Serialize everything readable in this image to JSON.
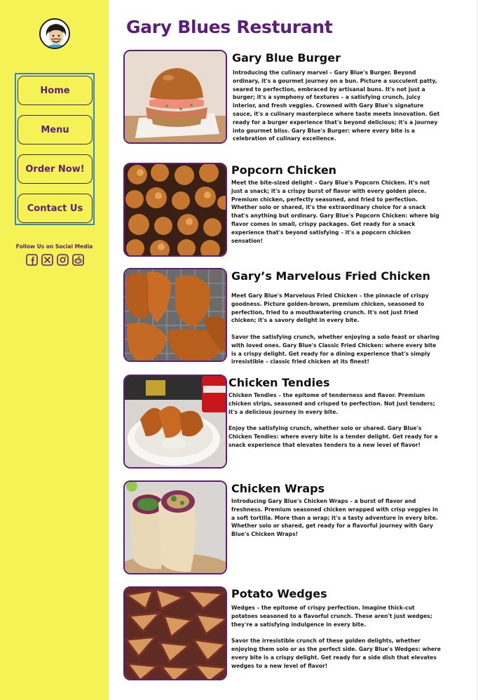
{
  "site": {
    "title": "Gary Blues Resturant"
  },
  "nav": {
    "home": "Home",
    "menu": "Menu",
    "order": "Order Now!",
    "contact": "Contact Us"
  },
  "social": {
    "label": "Follow Us on Social Media",
    "icons": [
      "facebook-icon",
      "x-icon",
      "instagram-icon",
      "reddit-icon"
    ]
  },
  "colors": {
    "sidebar": "#f5f255",
    "accent": "#5b1e7a",
    "nav_border": "#2a86d8"
  },
  "items": [
    {
      "name": "Gary Blue Burger",
      "paragraphs": [
        "Introducing the culinary marvel – Gary Blue's Burger. Beyond ordinary, it's a gourmet journey on a bun. Picture a succulent patty, seared to perfection, embraced by artisanal buns. It's not just a burger; it's a symphony of textures – a satisfying crunch, juicy interior, and fresh veggies. Crowned with Gary Blue's signature sauce, it's a culinary masterpiece where taste meets innovation. Get ready for a burger experience that's beyond delicious; it's a journey into gourmet bliss. Gary Blue's Burger: where every bite is a celebration of culinary excellence."
      ]
    },
    {
      "name": "Popcorn Chicken",
      "paragraphs": [
        "Meet the bite-sized delight – Gary Blue's Popcorn Chicken. It's not just a snack; it's a crispy burst of flavor with every golden piece. Premium chicken, perfectly seasoned, and fried to perfection. Whether solo or shared, it's the extraordinary choice for a snack that's anything but ordinary. Gary Blue's Popcorn Chicken: where big flavor comes in small, crispy packages. Get ready for a snack experience that's beyond satisfying – it's a popcorn chicken sensation!"
      ]
    },
    {
      "name": "Gary’s Marvelous Fried Chicken",
      "paragraphs": [
        "Meet Gary Blue's Marvelous Fried Chicken – the pinnacle of crispy goodness. Picture golden-brown, premium chicken, seasoned to perfection, fried to a mouthwatering crunch. It's not just fried chicken; it's a savory delight in every bite.",
        "Savor the satisfying crunch, whether enjoying a solo feast or sharing with loved ones. Gary Blue's Classic Fried Chicken: where every bite is a crispy delight. Get ready for a dining experience that's simply irresistible – classic fried chicken at its finest!"
      ]
    },
    {
      "name": "Chicken Tendies",
      "paragraphs": [
        "Chicken Tendies – the epitome of tenderness and flavor. Premium chicken strips, seasoned and crisped to perfection. Not just tenders; it's a delicious journey in every bite.",
        "Enjoy the satisfying crunch, whether solo or shared. Gary Blue's Chicken Tendies: where every bite is a tender delight. Get ready for a snack experience that elevates tenders to a new level of flavor!"
      ]
    },
    {
      "name": "Chicken Wraps",
      "paragraphs": [
        "Introducing Gary Blue's Chicken Wraps – a burst of flavor and freshness. Premium seasoned chicken wrapped with crisp veggies in a soft tortilla. More than a wrap; it's a tasty adventure in every bite. Whether solo or shared, get ready for a flavorful journey with Gary Blue's Chicken Wraps!"
      ]
    },
    {
      "name": "Potato Wedges",
      "paragraphs": [
        "Wedges – the epitome of crispy perfection. Imagine thick-cut potatoes seasoned to a flavorful crunch. These aren't just wedges; they're a satisfying indulgence in every bite.",
        "Savor the irresistible crunch of these golden delights, whether enjoying them solo or as the perfect side. Gary Blue's Wedges: where every bite is a crispy delight. Get ready for a side dish that elevates wedges to a new level of flavor!"
      ]
    }
  ]
}
